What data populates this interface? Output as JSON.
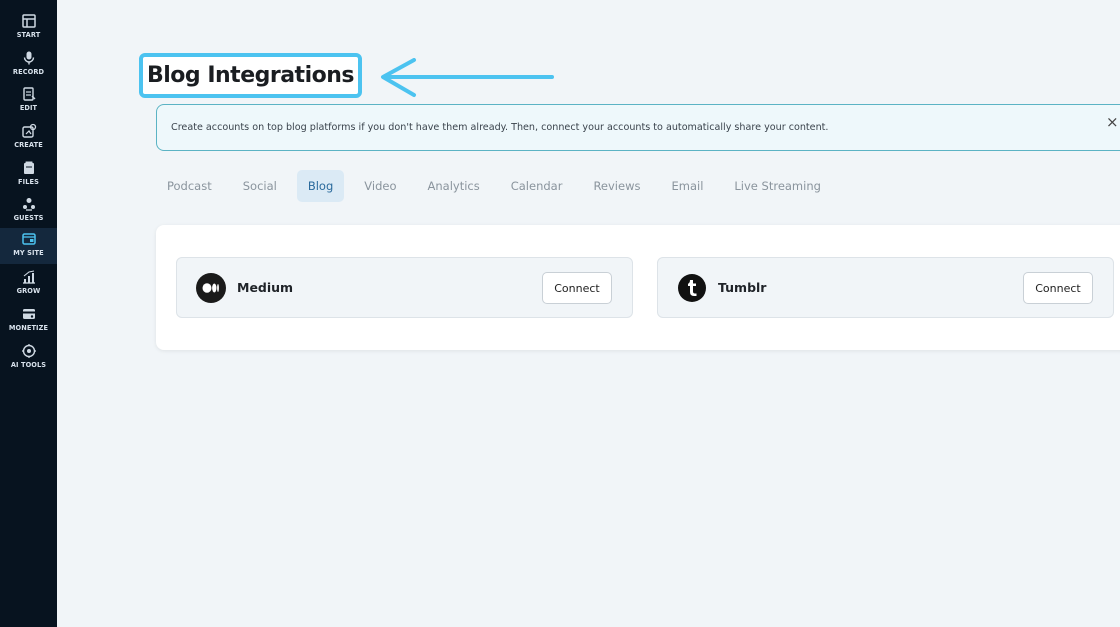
{
  "sidebar": {
    "items": [
      {
        "label": "START",
        "icon": "start-icon"
      },
      {
        "label": "RECORD",
        "icon": "microphone-icon"
      },
      {
        "label": "EDIT",
        "icon": "edit-icon"
      },
      {
        "label": "CREATE",
        "icon": "create-icon"
      },
      {
        "label": "FILES",
        "icon": "files-icon"
      },
      {
        "label": "GUESTS",
        "icon": "guests-icon"
      },
      {
        "label": "MY SITE",
        "icon": "my-site-icon"
      },
      {
        "label": "GROW",
        "icon": "grow-icon"
      },
      {
        "label": "MONETIZE",
        "icon": "monetize-icon"
      },
      {
        "label": "AI TOOLS",
        "icon": "ai-tools-icon"
      }
    ],
    "active": "MY SITE"
  },
  "page": {
    "title": "Blog Integrations",
    "info_text": "Create accounts on top blog platforms if you don't have them already. Then, connect your accounts to automatically share your content.",
    "close_label": "×"
  },
  "tabs": [
    {
      "label": "Podcast"
    },
    {
      "label": "Social"
    },
    {
      "label": "Blog"
    },
    {
      "label": "Video"
    },
    {
      "label": "Analytics"
    },
    {
      "label": "Calendar"
    },
    {
      "label": "Reviews"
    },
    {
      "label": "Email"
    },
    {
      "label": "Live Streaming"
    }
  ],
  "active_tab": "Blog",
  "integrations": [
    {
      "name": "Medium",
      "icon": "medium-logo-icon",
      "button_label": "Connect"
    },
    {
      "name": "Tumblr",
      "icon": "tumblr-logo-icon",
      "button_label": "Connect"
    }
  ],
  "colors": {
    "sidebar_bg": "#07131f",
    "highlight": "#4cc3f0",
    "active_tab_bg": "#dbeaf5",
    "banner_border": "#5bb3c4"
  }
}
